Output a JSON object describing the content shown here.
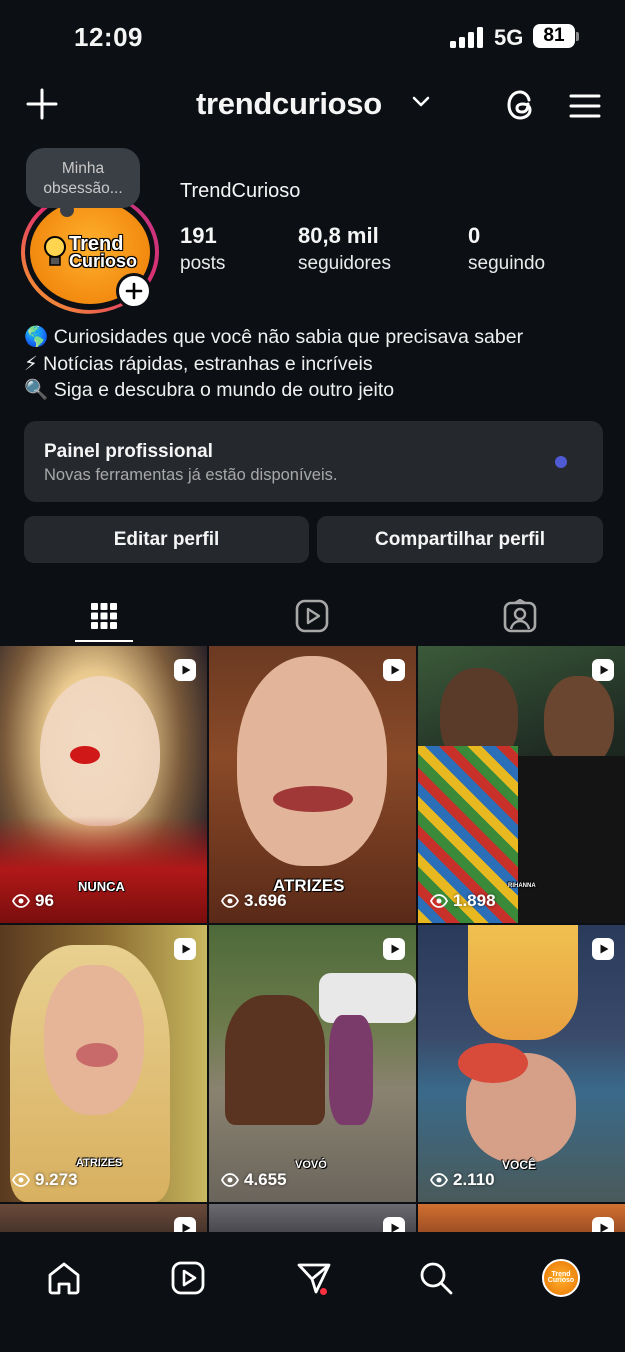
{
  "status_bar": {
    "time": "12:09",
    "network": "5G",
    "battery": "81"
  },
  "header": {
    "username": "trendcurioso"
  },
  "profile": {
    "note": "Minha obsessão...",
    "avatar_logo": [
      "Trend",
      "Curioso"
    ],
    "display_name": "TrendCurioso",
    "stats": [
      {
        "value": "191",
        "label": "posts"
      },
      {
        "value": "80,8 mil",
        "label": "seguidores"
      },
      {
        "value": "0",
        "label": "seguindo"
      }
    ],
    "bio": [
      "🌎 Curiosidades que você não sabia que precisava saber",
      "⚡ Notícias rápidas, estranhas e incríveis",
      "🔍 Siga e descubra o mundo de outro jeito"
    ]
  },
  "pro_panel": {
    "title": "Painel profissional",
    "subtitle": "Novas ferramentas já estão disponíveis."
  },
  "actions": {
    "edit": "Editar perfil",
    "share": "Compartilhar perfil"
  },
  "grid": [
    {
      "views": "96",
      "caption": "NUNCA"
    },
    {
      "views": "3.696",
      "caption": "ATRIZES"
    },
    {
      "views": "1.898",
      "caption": "RIHANNA"
    },
    {
      "views": "9.273",
      "caption": "ATRIZES"
    },
    {
      "views": "4.655",
      "caption": "VOVÓ"
    },
    {
      "views": "2.110",
      "caption": "VOCÊ"
    }
  ],
  "colors": {
    "background": "#0c1014",
    "surface": "#25292e",
    "accent_dot": "#4f5bd5",
    "notification": "#ff3040"
  }
}
